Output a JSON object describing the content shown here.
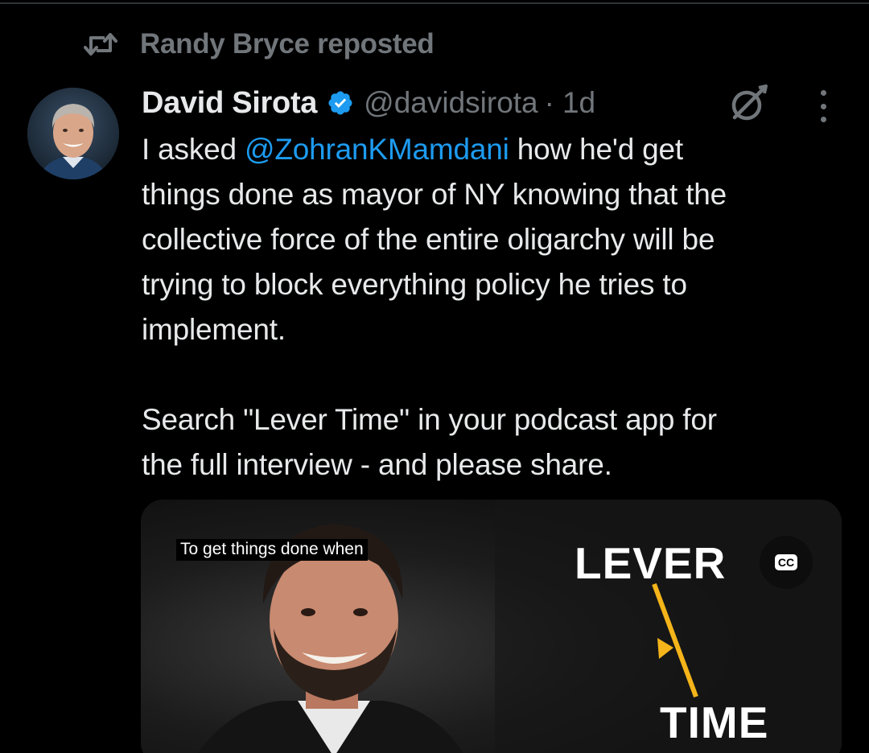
{
  "repost": {
    "text": "Randy Bryce reposted",
    "icon": "repost-icon"
  },
  "tweet": {
    "author_name": "David Sirota",
    "verified_icon": "verified-badge-icon",
    "handle": "@davidsirota",
    "separator": "·",
    "time": "1d",
    "body_lines": [
      {
        "before": "I asked ",
        "mention": "@ZohranKMamdani",
        "after": " how he'd get"
      },
      "things done as mayor of NY knowing that the",
      "collective force of the entire oligarchy will be",
      "trying to block everything policy he tries to",
      "implement.",
      "Search \"Lever Time\" in your podcast app for",
      "the full interview - and please share."
    ]
  },
  "media": {
    "caption": "To get things done when",
    "cc_label": "CC",
    "logo_top": "LEVER",
    "logo_bottom": "TIME"
  },
  "colors": {
    "background": "#000000",
    "text": "#e7e9ea",
    "muted": "#71767b",
    "link": "#1d9bf0",
    "accent_yellow": "#f4b41a"
  }
}
